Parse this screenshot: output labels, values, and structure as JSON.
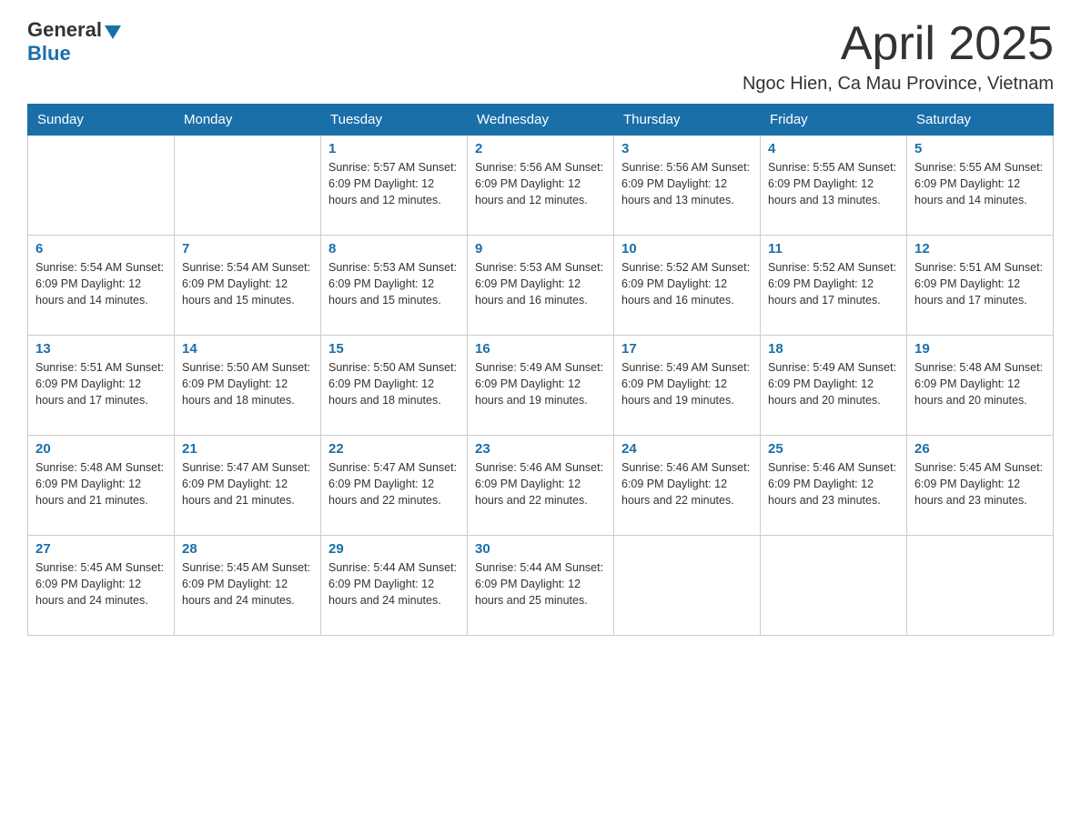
{
  "header": {
    "logo_general": "General",
    "logo_blue": "Blue",
    "month_title": "April 2025",
    "location": "Ngoc Hien, Ca Mau Province, Vietnam"
  },
  "calendar": {
    "days_of_week": [
      "Sunday",
      "Monday",
      "Tuesday",
      "Wednesday",
      "Thursday",
      "Friday",
      "Saturday"
    ],
    "weeks": [
      [
        {
          "day": "",
          "info": ""
        },
        {
          "day": "",
          "info": ""
        },
        {
          "day": "1",
          "info": "Sunrise: 5:57 AM\nSunset: 6:09 PM\nDaylight: 12 hours\nand 12 minutes."
        },
        {
          "day": "2",
          "info": "Sunrise: 5:56 AM\nSunset: 6:09 PM\nDaylight: 12 hours\nand 12 minutes."
        },
        {
          "day": "3",
          "info": "Sunrise: 5:56 AM\nSunset: 6:09 PM\nDaylight: 12 hours\nand 13 minutes."
        },
        {
          "day": "4",
          "info": "Sunrise: 5:55 AM\nSunset: 6:09 PM\nDaylight: 12 hours\nand 13 minutes."
        },
        {
          "day": "5",
          "info": "Sunrise: 5:55 AM\nSunset: 6:09 PM\nDaylight: 12 hours\nand 14 minutes."
        }
      ],
      [
        {
          "day": "6",
          "info": "Sunrise: 5:54 AM\nSunset: 6:09 PM\nDaylight: 12 hours\nand 14 minutes."
        },
        {
          "day": "7",
          "info": "Sunrise: 5:54 AM\nSunset: 6:09 PM\nDaylight: 12 hours\nand 15 minutes."
        },
        {
          "day": "8",
          "info": "Sunrise: 5:53 AM\nSunset: 6:09 PM\nDaylight: 12 hours\nand 15 minutes."
        },
        {
          "day": "9",
          "info": "Sunrise: 5:53 AM\nSunset: 6:09 PM\nDaylight: 12 hours\nand 16 minutes."
        },
        {
          "day": "10",
          "info": "Sunrise: 5:52 AM\nSunset: 6:09 PM\nDaylight: 12 hours\nand 16 minutes."
        },
        {
          "day": "11",
          "info": "Sunrise: 5:52 AM\nSunset: 6:09 PM\nDaylight: 12 hours\nand 17 minutes."
        },
        {
          "day": "12",
          "info": "Sunrise: 5:51 AM\nSunset: 6:09 PM\nDaylight: 12 hours\nand 17 minutes."
        }
      ],
      [
        {
          "day": "13",
          "info": "Sunrise: 5:51 AM\nSunset: 6:09 PM\nDaylight: 12 hours\nand 17 minutes."
        },
        {
          "day": "14",
          "info": "Sunrise: 5:50 AM\nSunset: 6:09 PM\nDaylight: 12 hours\nand 18 minutes."
        },
        {
          "day": "15",
          "info": "Sunrise: 5:50 AM\nSunset: 6:09 PM\nDaylight: 12 hours\nand 18 minutes."
        },
        {
          "day": "16",
          "info": "Sunrise: 5:49 AM\nSunset: 6:09 PM\nDaylight: 12 hours\nand 19 minutes."
        },
        {
          "day": "17",
          "info": "Sunrise: 5:49 AM\nSunset: 6:09 PM\nDaylight: 12 hours\nand 19 minutes."
        },
        {
          "day": "18",
          "info": "Sunrise: 5:49 AM\nSunset: 6:09 PM\nDaylight: 12 hours\nand 20 minutes."
        },
        {
          "day": "19",
          "info": "Sunrise: 5:48 AM\nSunset: 6:09 PM\nDaylight: 12 hours\nand 20 minutes."
        }
      ],
      [
        {
          "day": "20",
          "info": "Sunrise: 5:48 AM\nSunset: 6:09 PM\nDaylight: 12 hours\nand 21 minutes."
        },
        {
          "day": "21",
          "info": "Sunrise: 5:47 AM\nSunset: 6:09 PM\nDaylight: 12 hours\nand 21 minutes."
        },
        {
          "day": "22",
          "info": "Sunrise: 5:47 AM\nSunset: 6:09 PM\nDaylight: 12 hours\nand 22 minutes."
        },
        {
          "day": "23",
          "info": "Sunrise: 5:46 AM\nSunset: 6:09 PM\nDaylight: 12 hours\nand 22 minutes."
        },
        {
          "day": "24",
          "info": "Sunrise: 5:46 AM\nSunset: 6:09 PM\nDaylight: 12 hours\nand 22 minutes."
        },
        {
          "day": "25",
          "info": "Sunrise: 5:46 AM\nSunset: 6:09 PM\nDaylight: 12 hours\nand 23 minutes."
        },
        {
          "day": "26",
          "info": "Sunrise: 5:45 AM\nSunset: 6:09 PM\nDaylight: 12 hours\nand 23 minutes."
        }
      ],
      [
        {
          "day": "27",
          "info": "Sunrise: 5:45 AM\nSunset: 6:09 PM\nDaylight: 12 hours\nand 24 minutes."
        },
        {
          "day": "28",
          "info": "Sunrise: 5:45 AM\nSunset: 6:09 PM\nDaylight: 12 hours\nand 24 minutes."
        },
        {
          "day": "29",
          "info": "Sunrise: 5:44 AM\nSunset: 6:09 PM\nDaylight: 12 hours\nand 24 minutes."
        },
        {
          "day": "30",
          "info": "Sunrise: 5:44 AM\nSunset: 6:09 PM\nDaylight: 12 hours\nand 25 minutes."
        },
        {
          "day": "",
          "info": ""
        },
        {
          "day": "",
          "info": ""
        },
        {
          "day": "",
          "info": ""
        }
      ]
    ]
  }
}
